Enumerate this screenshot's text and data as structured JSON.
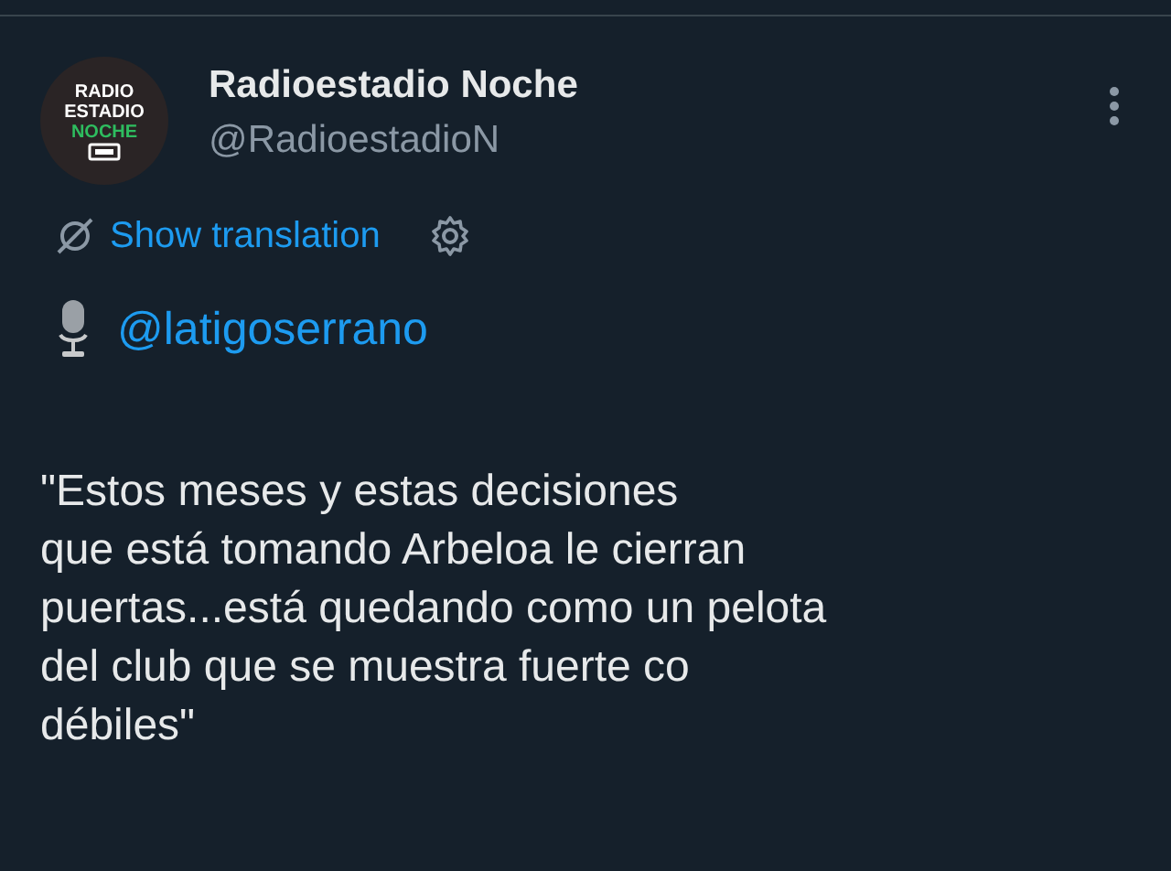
{
  "post": {
    "avatar_text": [
      "RADIO",
      "ESTADIO",
      "NOCHE"
    ],
    "author": {
      "name": "Radioestadio Noche",
      "handle": "@RadioestadioN"
    },
    "translation_link": "Show translation",
    "mention": "@latigoserrano",
    "body_lines": [
      "\"Estos meses y estas decisiones",
      "que está tomando Arbeloa le cierran",
      "puertas...está quedando como un pelota",
      "del club que se muestra fuerte co",
      "débiles\""
    ]
  }
}
